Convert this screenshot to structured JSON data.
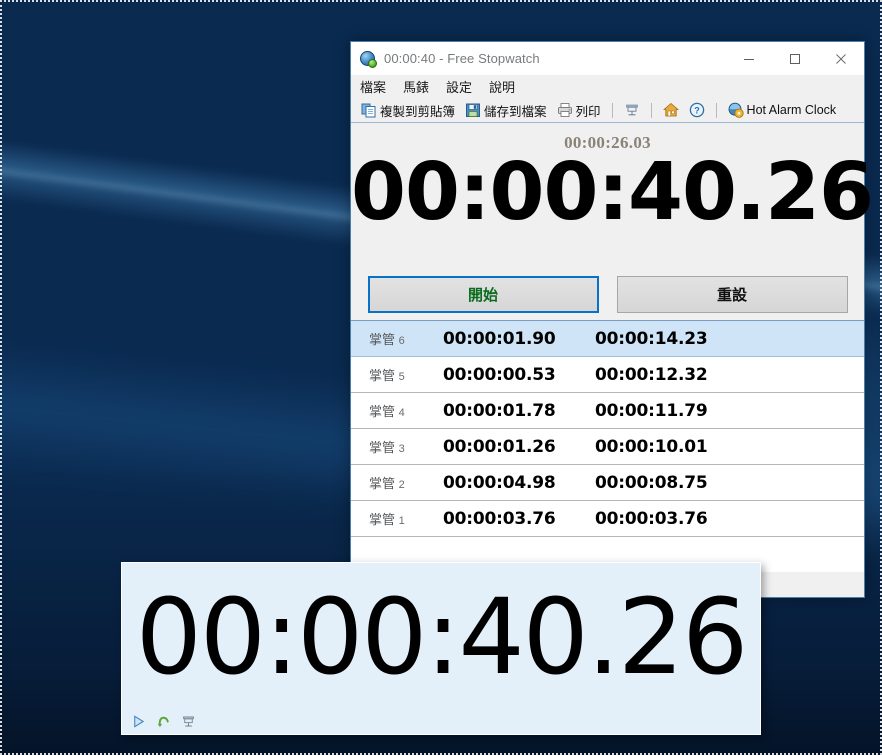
{
  "window": {
    "title": "00:00:40 - Free Stopwatch",
    "app_icon": "stopwatch-globe-icon",
    "controls": {
      "minimize": "minimize-icon",
      "maximize": "maximize-icon",
      "close": "close-icon"
    }
  },
  "menubar": {
    "items": [
      {
        "label": "檔案",
        "name": "menu-file"
      },
      {
        "label": "馬錶",
        "name": "menu-stopwatch"
      },
      {
        "label": "設定",
        "name": "menu-settings"
      },
      {
        "label": "說明",
        "name": "menu-help"
      }
    ]
  },
  "toolbar": {
    "copy_clipboard": "複製到剪貼簿",
    "save_file": "儲存到檔案",
    "print": "列印",
    "hot_alarm_clock": "Hot Alarm Clock",
    "icons": {
      "copy": "copy-icon",
      "save": "floppy-save-icon",
      "print": "printer-icon",
      "lap": "lap-flag-icon",
      "home": "home-icon",
      "help": "help-question-icon",
      "hot_alarm": "hot-alarm-clock-icon"
    }
  },
  "display": {
    "split_time": "00:00:26.03",
    "main_time": "00:00:40.26"
  },
  "buttons": {
    "start": "開始",
    "reset": "重設",
    "start_color": "#0a6b1e",
    "start_focus_border": "#0a72c6"
  },
  "laps": {
    "selected_index": 0,
    "rows": [
      {
        "name": "掌管",
        "number": "6",
        "split": "00:00:01.90",
        "total": "00:00:14.23"
      },
      {
        "name": "掌管",
        "number": "5",
        "split": "00:00:00.53",
        "total": "00:00:12.32"
      },
      {
        "name": "掌管",
        "number": "4",
        "split": "00:00:01.78",
        "total": "00:00:11.79"
      },
      {
        "name": "掌管",
        "number": "3",
        "split": "00:00:01.26",
        "total": "00:00:10.01"
      },
      {
        "name": "掌管",
        "number": "2",
        "split": "00:00:04.98",
        "total": "00:00:08.75"
      },
      {
        "name": "掌管",
        "number": "1",
        "split": "00:00:03.76",
        "total": "00:00:03.76"
      }
    ]
  },
  "overlay": {
    "time": "00:00:40.26",
    "background": "#e3f0fa",
    "icons": {
      "play": "play-triangle-icon",
      "reset": "reset-loop-icon",
      "lap": "lap-flag-icon"
    }
  }
}
